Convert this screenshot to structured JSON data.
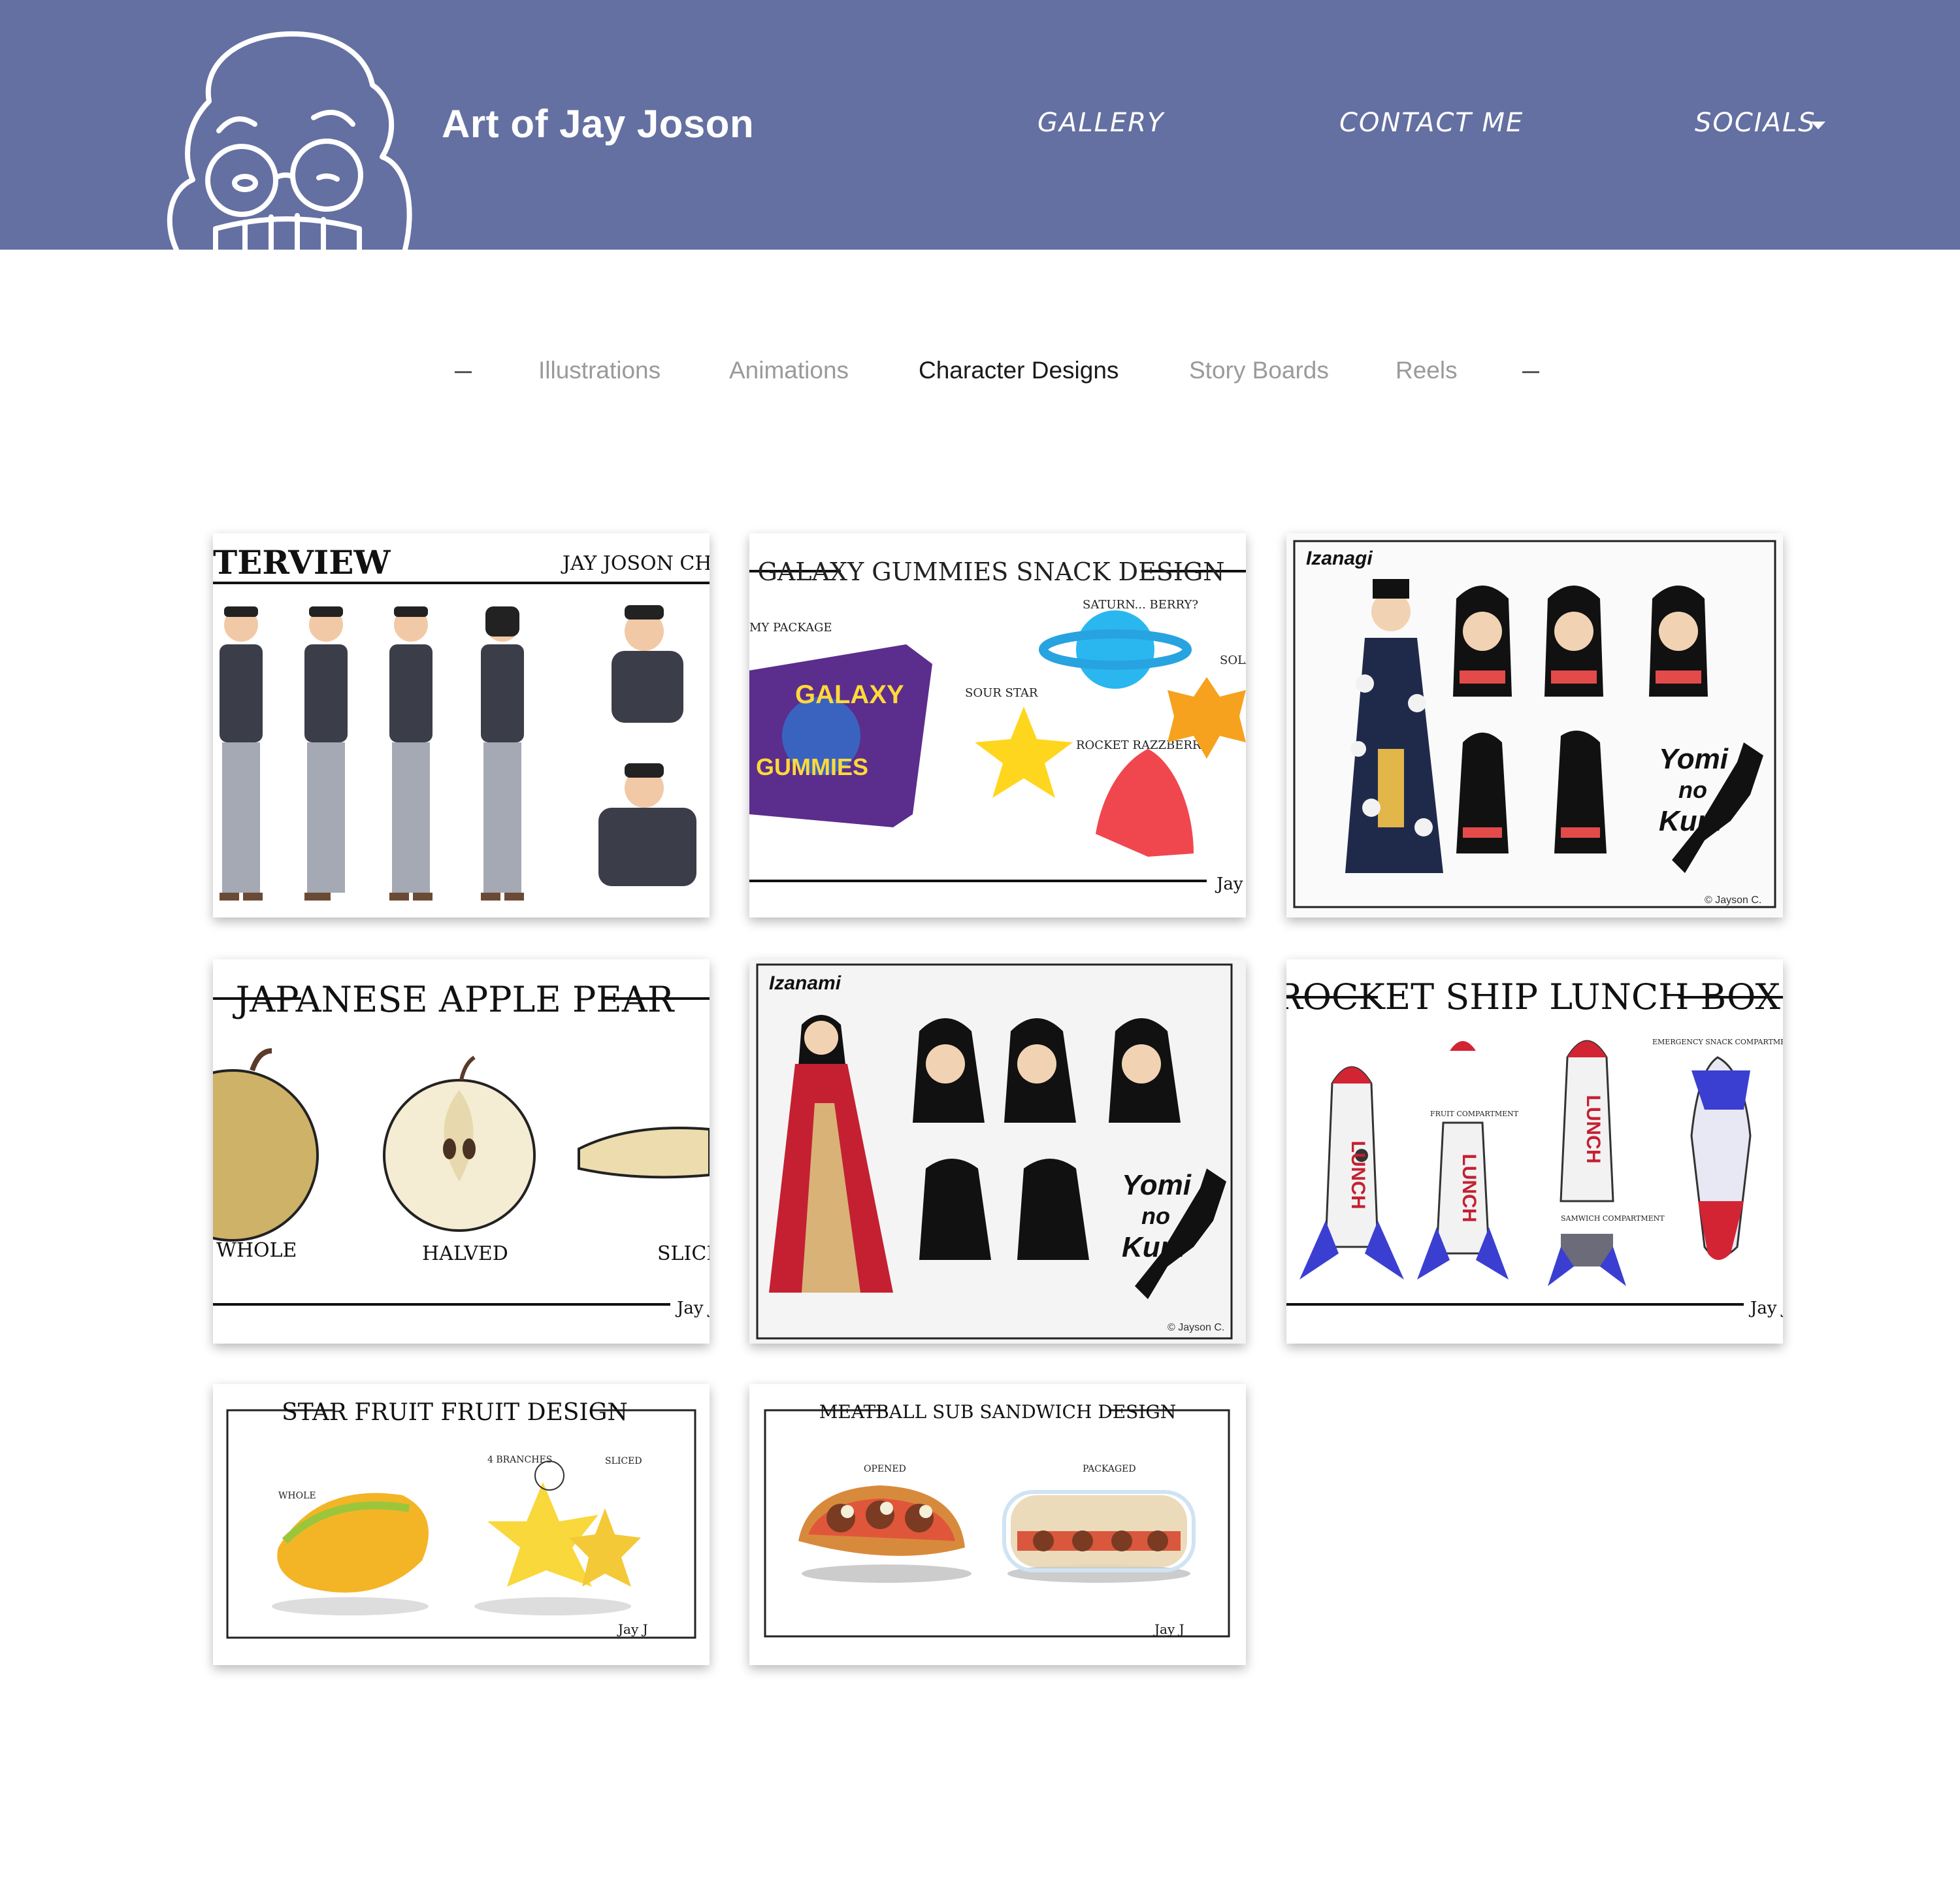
{
  "header": {
    "site_title": "Art of Jay Joson",
    "logo_icon": "cartoon-face-logo",
    "nav": {
      "gallery": "GALLERY",
      "contact": "CONTACT ME",
      "socials": "SOCIALS"
    },
    "background_color": "#6470a1"
  },
  "tabs": {
    "items": [
      "Illustrations",
      "Animations",
      "Character Designs",
      "Story Boards",
      "Reels"
    ],
    "active": "Character Designs"
  },
  "gallery": {
    "cards": [
      {
        "id": "interview",
        "title": "TERVIEW",
        "subtitle": "JAY JOSON CHARACT"
      },
      {
        "id": "galaxy",
        "title": "GALAXY GUMMIES SNACK DESIGN",
        "labels": [
          "MY PACKAGE",
          "SATURN... BERRY?",
          "SOUR STAR",
          "ROCKET RAZZBERRY",
          "SOLAR",
          "GALAXY",
          "GUMMIES"
        ]
      },
      {
        "id": "izanagi",
        "title": "Izanagi",
        "labels": [
          "Yomi",
          "no",
          "Kuni",
          "© Jayson C."
        ]
      },
      {
        "id": "apple-pear",
        "title": "JAPANESE APPLE PEAR",
        "labels": [
          "WHOLE",
          "HALVED",
          "SLICED"
        ]
      },
      {
        "id": "izanami",
        "title": "Izanami",
        "labels": [
          "Yomi",
          "no",
          "Kuni",
          "© Jayson C."
        ]
      },
      {
        "id": "rocket",
        "title": "ROCKET SHIP LUNCH BOX",
        "labels": [
          "LUNCH",
          "EMERGENCY SNACK COMPARTMENT",
          "FRUIT COMPARTMENT",
          "SAMWICH COMPARTMENT"
        ]
      },
      {
        "id": "starfruit",
        "title": "STAR FRUIT FRUIT DESIGN",
        "labels": [
          "WHOLE",
          "4 BRANCHES",
          "SLICED"
        ]
      },
      {
        "id": "meatball",
        "title": "MEATBALL SUB SANDWICH DESIGN",
        "labels": [
          "OPENED",
          "PACKAGED"
        ]
      }
    ],
    "signature": "Jay J"
  }
}
